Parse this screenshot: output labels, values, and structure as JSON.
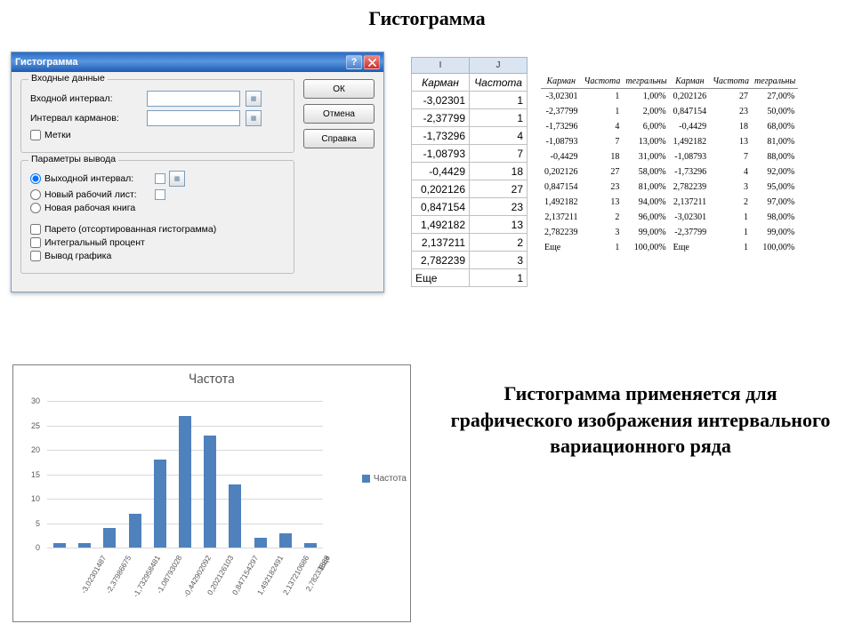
{
  "page_title": "Гистограмма",
  "dialog": {
    "title": "Гистограмма",
    "buttons": {
      "ok": "ОК",
      "cancel": "Отмена",
      "help": "Справка"
    },
    "group_input": {
      "legend": "Входные данные",
      "input_range": "Входной интервал:",
      "bin_range": "Интервал карманов:",
      "labels": "Метки"
    },
    "group_output": {
      "legend": "Параметры вывода",
      "out_range": "Выходной интервал:",
      "new_sheet": "Новый рабочий лист:",
      "new_book": "Новая рабочая книга",
      "pareto": "Парето (отсортированная гистограмма)",
      "integral": "Интегральный процент",
      "chart_out": "Вывод графика"
    }
  },
  "xl_columns": {
    "I": "I",
    "J": "J"
  },
  "xl_headers": {
    "bin": "Карман",
    "freq": "Частота"
  },
  "xl_rows": [
    {
      "bin": "-3,02301",
      "freq": "1"
    },
    {
      "bin": "-2,37799",
      "freq": "1"
    },
    {
      "bin": "-1,73296",
      "freq": "4"
    },
    {
      "bin": "-1,08793",
      "freq": "7"
    },
    {
      "bin": "-0,4429",
      "freq": "18"
    },
    {
      "bin": "0,202126",
      "freq": "27"
    },
    {
      "bin": "0,847154",
      "freq": "23"
    },
    {
      "bin": "1,492182",
      "freq": "13"
    },
    {
      "bin": "2,137211",
      "freq": "2"
    },
    {
      "bin": "2,782239",
      "freq": "3"
    },
    {
      "bin": "Еще",
      "freq": "1"
    }
  ],
  "wide_headers": {
    "bin1": "Карман",
    "freq1": "Частота",
    "int1": "тегральны",
    "bin2": "Карман",
    "freq2": "Частота",
    "int2": "тегральны"
  },
  "wide_rows": [
    {
      "b1": "-3,02301",
      "f1": "1",
      "i1": "1,00%",
      "b2": "0,202126",
      "f2": "27",
      "i2": "27,00%"
    },
    {
      "b1": "-2,37799",
      "f1": "1",
      "i1": "2,00%",
      "b2": "0,847154",
      "f2": "23",
      "i2": "50,00%"
    },
    {
      "b1": "-1,73296",
      "f1": "4",
      "i1": "6,00%",
      "b2": "-0,4429",
      "f2": "18",
      "i2": "68,00%"
    },
    {
      "b1": "-1,08793",
      "f1": "7",
      "i1": "13,00%",
      "b2": "1,492182",
      "f2": "13",
      "i2": "81,00%"
    },
    {
      "b1": "-0,4429",
      "f1": "18",
      "i1": "31,00%",
      "b2": "-1,08793",
      "f2": "7",
      "i2": "88,00%"
    },
    {
      "b1": "0,202126",
      "f1": "27",
      "i1": "58,00%",
      "b2": "-1,73296",
      "f2": "4",
      "i2": "92,00%"
    },
    {
      "b1": "0,847154",
      "f1": "23",
      "i1": "81,00%",
      "b2": "2,782239",
      "f2": "3",
      "i2": "95,00%"
    },
    {
      "b1": "1,492182",
      "f1": "13",
      "i1": "94,00%",
      "b2": "2,137211",
      "f2": "2",
      "i2": "97,00%"
    },
    {
      "b1": "2,137211",
      "f1": "2",
      "i1": "96,00%",
      "b2": "-3,02301",
      "f2": "1",
      "i2": "98,00%"
    },
    {
      "b1": "2,782239",
      "f1": "3",
      "i1": "99,00%",
      "b2": "-2,37799",
      "f2": "1",
      "i2": "99,00%"
    },
    {
      "b1": "Еще",
      "f1": "1",
      "i1": "100,00%",
      "b2": "Еще",
      "f2": "1",
      "i2": "100,00%"
    }
  ],
  "description": "Гистограмма применяется для графического изображения интервального вариационного ряда",
  "chart_data": {
    "type": "bar",
    "title": "Частота",
    "legend": "Частота",
    "ylabel": "",
    "ylim": [
      0,
      30
    ],
    "yticks": [
      0,
      5,
      10,
      15,
      20,
      25,
      30
    ],
    "categories": [
      "-3,02301487",
      "-2,37986675",
      "-1,732958481",
      "-1,08793028",
      "-0,442902092",
      "0,202126103",
      "0,847154297",
      "1,492182491",
      "2,137210686",
      "2,78233888",
      "Еще"
    ],
    "values": [
      1,
      1,
      4,
      7,
      18,
      27,
      23,
      13,
      2,
      3,
      1
    ]
  }
}
